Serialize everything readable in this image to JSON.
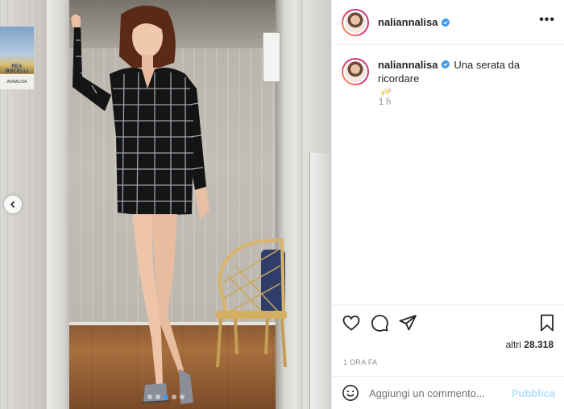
{
  "post": {
    "username": "naliannalisa",
    "more_icon": "more-horizontal-icon",
    "caption_text": "Una serata da ricordare",
    "caption_emoji": "🥂",
    "relative_time": "1 h",
    "likes_prefix": "altri",
    "likes_count": "28.318",
    "date_label": "1 ORA FA"
  },
  "photo": {
    "poster_title": "REA BOCELLI",
    "poster_subtitle": "ANNALISA",
    "carousel_dots": 5,
    "active_dot": 2
  },
  "comment": {
    "placeholder": "Aggiungi un commento...",
    "post_label": "Pubblica"
  },
  "colors": {
    "verified_blue": "#3897f0",
    "post_button_disabled": "#b2dffc",
    "muted_text": "#8e8e8e"
  },
  "icons": {
    "like": "heart-icon",
    "comment": "comment-icon",
    "share": "paper-plane-icon",
    "save": "bookmark-icon",
    "emoji": "smiley-icon",
    "prev": "chevron-left-icon",
    "verified": "verified-badge-icon"
  }
}
